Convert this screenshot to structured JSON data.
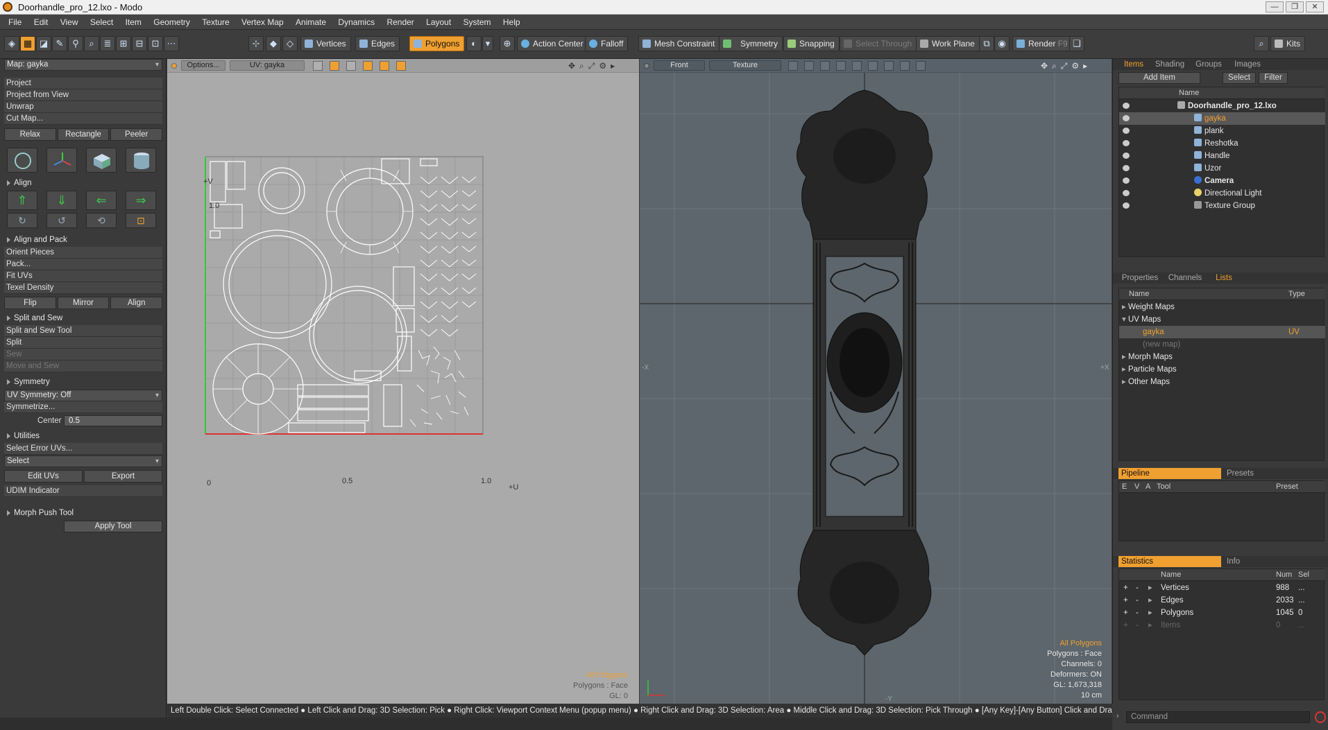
{
  "window": {
    "title": "Doorhandle_pro_12.lxo - Modo",
    "min": "—",
    "max": "❐",
    "close": "✕"
  },
  "menu": [
    "File",
    "Edit",
    "View",
    "Select",
    "Item",
    "Geometry",
    "Texture",
    "Vertex Map",
    "Animate",
    "Dynamics",
    "Render",
    "Layout",
    "System",
    "Help"
  ],
  "toolbar": {
    "vertices": "Vertices",
    "edges": "Edges",
    "polygons": "Polygons",
    "action_center": "Action Center",
    "falloff": "Falloff",
    "mesh_constraint": "Mesh Constraint",
    "symmetry": "Symmetry",
    "snapping": "Snapping",
    "select_through": "Select Through",
    "work_plane": "Work Plane",
    "render": "Render",
    "render_key": "F9",
    "kits": "Kits"
  },
  "left": {
    "map_select": "Map: gayka",
    "project": "Project",
    "project_from_view": "Project from View",
    "unwrap": "Unwrap",
    "cut_map": "Cut Map...",
    "relax": "Relax",
    "rectangle": "Rectangle",
    "peeler": "Peeler",
    "align_head": "Align",
    "align_pack_head": "Align and Pack",
    "orient_pieces": "Orient Pieces",
    "pack": "Pack...",
    "fit_uvs": "Fit UVs",
    "texel_density": "Texel Density",
    "flip": "Flip",
    "mirror": "Mirror",
    "align": "Align",
    "split_sew_head": "Split and Sew",
    "split_sew_tool": "Split and Sew Tool",
    "split": "Split",
    "sew": "Sew",
    "move_and_sew": "Move and Sew",
    "symmetry_head": "Symmetry",
    "uv_symmetry": "UV Symmetry: Off",
    "symmetrize": "Symmetrize...",
    "center_label": "Center",
    "center_value": "0.5",
    "utilities_head": "Utilities",
    "select_error_uvs": "Select Error UVs...",
    "select": "Select",
    "edit_uvs": "Edit UVs",
    "export": "Export",
    "udim_indicator": "UDIM Indicator",
    "morph_push_tool": "Morph Push Tool",
    "apply_tool": "Apply Tool"
  },
  "uv_view": {
    "options": "Options...",
    "uv_map": "UV: gayka",
    "plus_v": "+V",
    "plus_u": "+U",
    "v_one": "1.0",
    "u_one": "1.0",
    "origin": "0",
    "half": "0.5",
    "all_polygons": "All Polygons",
    "polygons_face": "Polygons : Face",
    "gl": "GL: 0"
  },
  "view3d": {
    "view": "Front",
    "shading": "Texture",
    "all_polygons": "All Polygons",
    "polygons_face": "Polygons : Face",
    "channels": "Channels: 0",
    "deformers": "Deformers: ON",
    "gl": "GL: 1,673,318",
    "scale": "10 cm",
    "x_neg": "-X",
    "x_pos": "+X",
    "y_neg": "-Y"
  },
  "items_panel": {
    "tabs": [
      "Items",
      "Shading",
      "Groups",
      "Images"
    ],
    "add_item": "Add Item",
    "select": "Select",
    "filter": "Filter",
    "name_col": "Name",
    "rows": [
      {
        "name": "Doorhandle_pro_12.lxo",
        "level": 0
      },
      {
        "name": "gayka",
        "level": 1
      },
      {
        "name": "plank",
        "level": 1
      },
      {
        "name": "Reshotka",
        "level": 1
      },
      {
        "name": "Handle",
        "level": 1
      },
      {
        "name": "Uzor",
        "level": 1
      },
      {
        "name": "Camera",
        "level": 1
      },
      {
        "name": "Directional Light",
        "level": 1
      },
      {
        "name": "Texture Group",
        "level": 1
      }
    ]
  },
  "lists_panel": {
    "tabs": [
      "Properties",
      "Channels",
      "Lists"
    ],
    "name_col": "Name",
    "type_col": "Type",
    "weight_maps": "Weight Maps",
    "uv_maps": "UV Maps",
    "gayka": "gayka",
    "gayka_type": "UV",
    "new_map": "(new map)",
    "morph_maps": "Morph Maps",
    "particle_maps": "Particle Maps",
    "other_maps": "Other Maps"
  },
  "pipeline": {
    "tab1": "Pipeline",
    "tab2": "Presets",
    "e": "E",
    "v": "V",
    "a": "A",
    "tool": "Tool",
    "preset": "Preset"
  },
  "statistics": {
    "tab1": "Statistics",
    "tab2": "Info",
    "name_col": "Name",
    "num_col": "Num",
    "sel_col": "Sel",
    "rows": [
      {
        "name": "Vertices",
        "num": "988",
        "sel": "..."
      },
      {
        "name": "Edges",
        "num": "2033",
        "sel": "..."
      },
      {
        "name": "Polygons",
        "num": "1045",
        "sel": "0"
      },
      {
        "name": "Items",
        "num": "0",
        "sel": "..."
      }
    ]
  },
  "status": "Left Double Click: Select Connected ● Left Click and Drag: 3D Selection: Pick ● Right Click: Viewport Context Menu (popup menu) ● Right Click and Drag: 3D Selection: Area ● Middle Click and Drag: 3D Selection: Pick Through ● [Any Key]-[Any Button] Click and Drag: dragDrop ...",
  "command_placeholder": "Command"
}
